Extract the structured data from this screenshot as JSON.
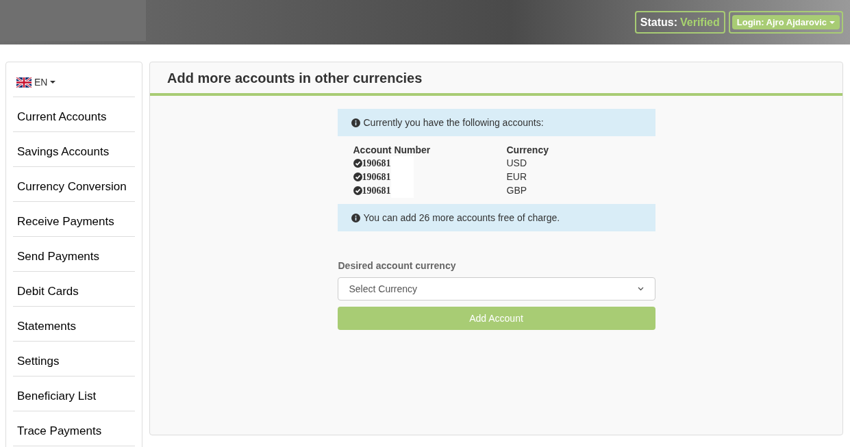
{
  "header": {
    "status_label": "Status:",
    "status_value": "Verified",
    "login": "Login: Ajro Ajdarovic"
  },
  "sidebar": {
    "language": "EN",
    "items": [
      {
        "label": "Current Accounts"
      },
      {
        "label": "Savings Accounts"
      },
      {
        "label": "Currency Conversion"
      },
      {
        "label": "Receive Payments"
      },
      {
        "label": "Send Payments"
      },
      {
        "label": "Debit Cards"
      },
      {
        "label": "Statements"
      },
      {
        "label": "Settings"
      },
      {
        "label": "Beneficiary List"
      },
      {
        "label": "Trace Payments"
      }
    ]
  },
  "panel": {
    "title": "Add more accounts in other currencies",
    "info": "Currently you have the following accounts:",
    "table": {
      "columns": [
        "Account Number",
        "Currency"
      ],
      "rows": [
        {
          "number": "190681",
          "currency": "USD"
        },
        {
          "number": "190681",
          "currency": "EUR"
        },
        {
          "number": "190681",
          "currency": "GBP"
        }
      ]
    },
    "note": "You can add 26 more accounts free of charge.",
    "field_label": "Desired account currency",
    "select": {
      "value": "Select Currency"
    },
    "button": "Add Account"
  }
}
